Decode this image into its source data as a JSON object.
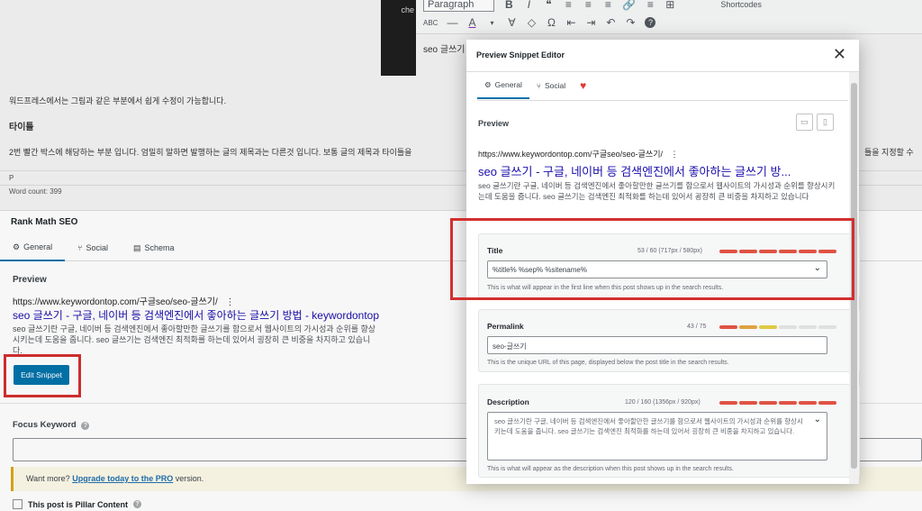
{
  "editor": {
    "paragraph": "Paragraph",
    "video_label": "che",
    "edit_text": "seo 글쓰기 ...",
    "toolbar_row1": [
      "B",
      "I",
      "❝",
      "≡",
      "≡",
      "≡",
      "🔗",
      "≡",
      "⊞",
      "Shortcodes"
    ],
    "toolbar_row2": [
      "ABC",
      "—",
      "A",
      "▾",
      "Ɐ",
      "◇",
      "Ω",
      "⇤",
      "⇥",
      "↶",
      "↷",
      "?"
    ],
    "content_line1": "워드프레스에서는 그림과 같은 부분에서 쉽게 수정이 가능합니다.",
    "content_heading": "타이틀",
    "content_line2": "2번 빨간 박스에 해당하는 부분 입니다. 엄밀히 말하면 발행하는 글의 제목과는 다른것 입니다. 보통 글의 제목과 타이틀을",
    "content_line2_tail": "틀을 지정할 수",
    "status_p": "P",
    "word_count": "Word count: 399"
  },
  "rankmath": {
    "title": "Rank Math SEO",
    "tabs": [
      {
        "label": "General",
        "icon": "gear-icon"
      },
      {
        "label": "Social",
        "icon": "share-icon"
      },
      {
        "label": "Schema",
        "icon": "schema-icon"
      }
    ],
    "preview_heading": "Preview",
    "url": "https://www.keywordontop.com/구글seo/seo-글쓰기/",
    "more": "⋮",
    "snippet_title": "seo 글쓰기 - 구글, 네이버 등 검색엔진에서 좋아하는 글쓰기 방법 - keywordontop",
    "snippet_desc": "seo 글쓰기란 구글, 네이버 등 검색엔진에서 좋아할만한 글쓰기를 함으로서 웹사이트의 가시성과 순위를 향상시키는데 도움을 줍니다. seo 글쓰기는 검색엔진 최적화를 하는데 있어서 굉장히 큰 비중을 차지하고 있습니다.",
    "edit_button": "Edit Snippet",
    "focus_keyword": "Focus Keyword",
    "notice_prefix": "Want more?",
    "notice_link": "Upgrade today to the PRO",
    "notice_suffix": "version.",
    "pillar": "This post is Pillar Content"
  },
  "modal": {
    "title": "Preview Snippet Editor",
    "close": "✕",
    "tabs": [
      {
        "label": "General",
        "icon": "gear-icon"
      },
      {
        "label": "Social",
        "icon": "share-icon"
      },
      {
        "label": "",
        "icon": "heart-icon"
      }
    ],
    "preview_heading": "Preview",
    "url": "https://www.keywordontop.com/구글seo/seo-글쓰기/",
    "more": "⋮",
    "snippet_title": "seo 글쓰기 - 구글, 네이버 등 검색엔진에서 좋아하는 글쓰기 방...",
    "snippet_desc": "seo 글쓰기란 구글, 네이버 등 검색엔진에서 좋아할만한 글쓰기를 함으로서 웹사이트의 가시성과 순위를 향상시키는데 도움을 줍니다. seo 글쓰기는 검색엔진 최적화를 하는데 있어서 굉장히 큰 비중을 차지하고 있습니다",
    "fields": {
      "title": {
        "label": "Title",
        "counter": "53 / 60 (717px / 580px)",
        "value": "%title% %sep% %sitename%",
        "hint": "This is what will appear in the first line when this post shows up in the search results.",
        "bar": [
          "#e05243",
          "#e05243",
          "#e05243",
          "#e05243",
          "#e05243",
          "#e05243"
        ]
      },
      "permalink": {
        "label": "Permalink",
        "counter": "43 / 75",
        "value": "seo-글쓰기",
        "hint": "This is the unique URL of this page, displayed below the post title in the search results.",
        "bar": [
          "#e05243",
          "#e0a243",
          "#e0c943",
          "#e0e0e0",
          "#e0e0e0",
          "#e0e0e0"
        ]
      },
      "description": {
        "label": "Description",
        "counter": "120 / 160 (1356px / 920px)",
        "value": "seo 글쓰기란 구글, 네이버 등 검색엔진에서 좋아할만한 글쓰기를 함으로서 웹사이트의 가시성과 순위를 향상시키는데 도움을 줍니다. seo 글쓰기는 검색엔진 최적화를 하는데 있어서 굉장히 큰 비중을 차지하고 있습니다.",
        "hint": "This is what will appear as the description when this post shows up in the search results.",
        "bar": [
          "#e05243",
          "#e05243",
          "#e05243",
          "#e05243",
          "#e05243",
          "#e05243"
        ]
      }
    }
  },
  "colors": {
    "accent": "#0073aa",
    "annotation_red": "#d32f2f",
    "link_blue": "#1a0dab"
  }
}
